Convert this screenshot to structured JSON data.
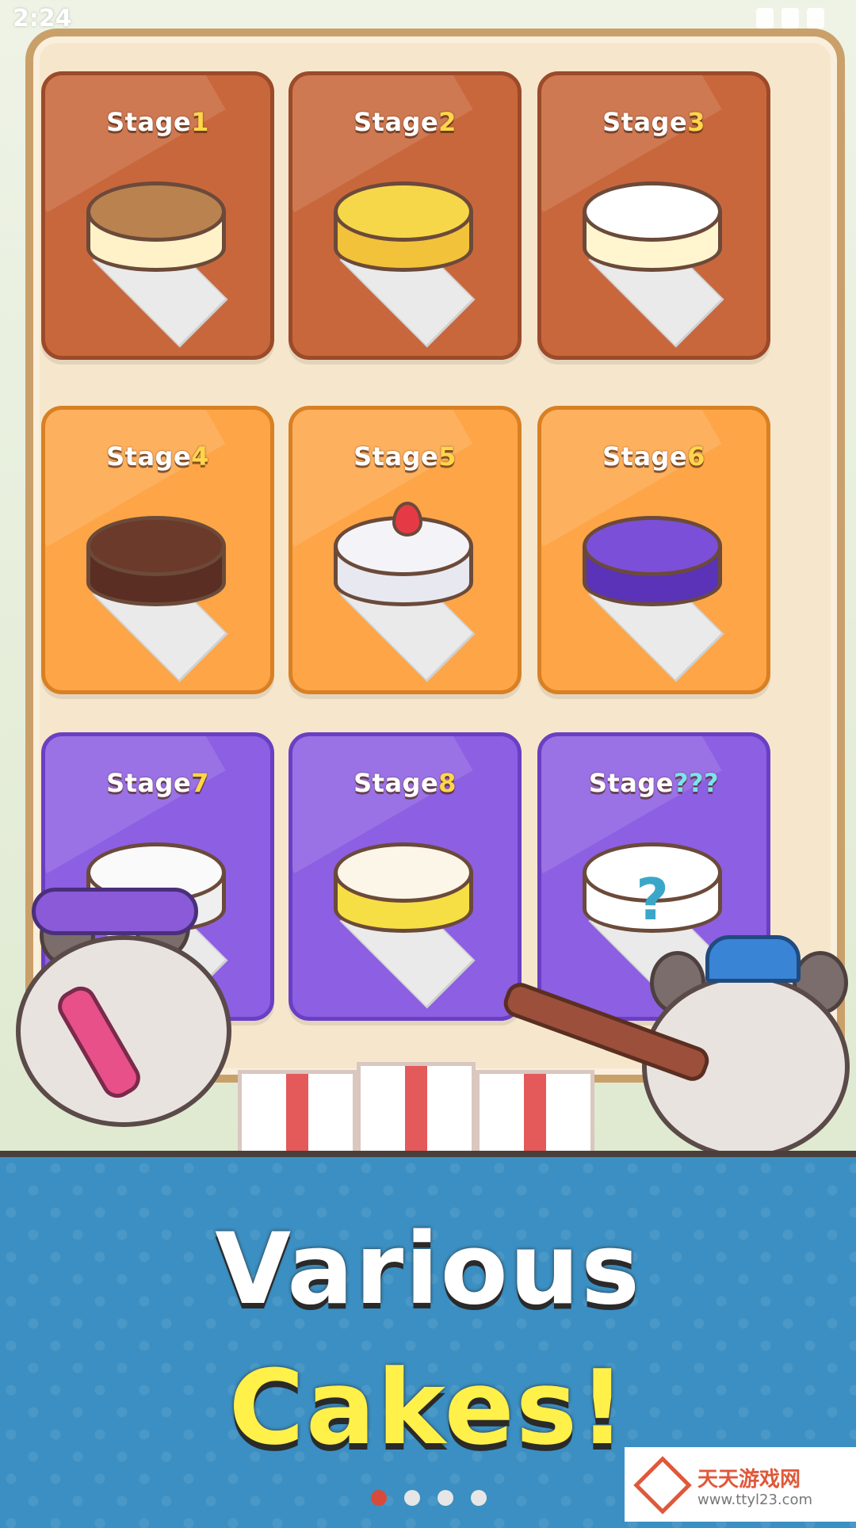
{
  "status_bar": {
    "time": "2:24"
  },
  "stages": [
    {
      "prefix": "Stage",
      "num": "1",
      "theme": "brown",
      "cake": "cheesecake",
      "top": "#b9824f",
      "side": "#fff2c8"
    },
    {
      "prefix": "Stage",
      "num": "2",
      "theme": "brown",
      "cake": "sponge",
      "top": "#f7d74a",
      "side": "#f2c23a"
    },
    {
      "prefix": "Stage",
      "num": "3",
      "theme": "brown",
      "cake": "cream",
      "top": "#ffffff",
      "side": "#fff6d0"
    },
    {
      "prefix": "Stage",
      "num": "4",
      "theme": "orange",
      "cake": "chocolate",
      "top": "#6b3a2a",
      "side": "#5a2e22"
    },
    {
      "prefix": "Stage",
      "num": "5",
      "theme": "orange",
      "cake": "strawberry",
      "top": "#f4f4f8",
      "side": "#e8e8f0"
    },
    {
      "prefix": "Stage",
      "num": "6",
      "theme": "orange",
      "cake": "galaxy",
      "top": "#7b4fd8",
      "side": "#5a33b8"
    },
    {
      "prefix": "Stage",
      "num": "7",
      "theme": "purple",
      "cake": "cookies-cream",
      "top": "#fafafa",
      "side": "#efefef"
    },
    {
      "prefix": "Stage",
      "num": "8",
      "theme": "purple",
      "cake": "lemon",
      "top": "#fbf6e8",
      "side": "#f6de45"
    },
    {
      "prefix": "Stage",
      "num": "???",
      "theme": "purple",
      "cake": "mystery",
      "top": "#ffffff",
      "side": "#ffffff"
    }
  ],
  "banner": {
    "line1": "Various",
    "line2": "Cakes!"
  },
  "pager": {
    "count": 4,
    "active": 0
  },
  "watermark": {
    "title": "天天游戏网",
    "url": "www.ttyl23.com"
  }
}
